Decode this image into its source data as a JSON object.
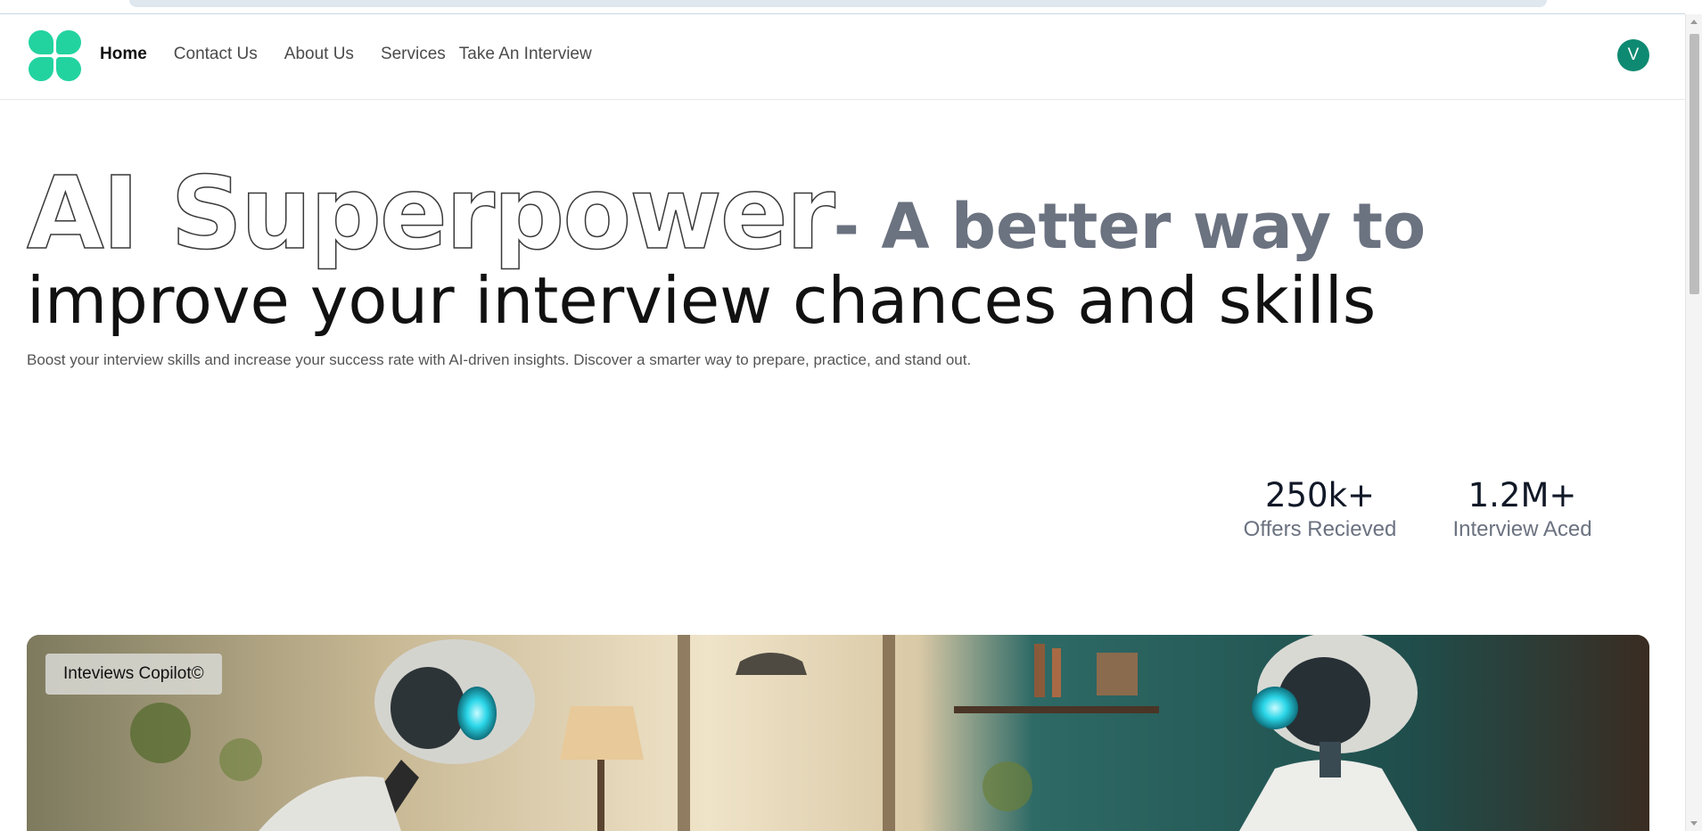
{
  "nav": {
    "home": "Home",
    "contact": "Contact Us",
    "about": "About Us",
    "services": "Services",
    "interview": "Take An Interview"
  },
  "user": {
    "avatar_initial": "V"
  },
  "hero": {
    "title_outline": "AI Superpower",
    "title_bold": "- A better way to",
    "title_line2": "improve your interview chances and skills",
    "subtitle": "Boost your interview skills and increase your success rate with AI-driven insights. Discover a smarter way to prepare, practice, and stand out."
  },
  "stats": [
    {
      "value": "250k+",
      "label": "Offers Recieved"
    },
    {
      "value": "1.2M+",
      "label": "Interview Aced"
    }
  ],
  "banner": {
    "badge": "Inteviews Copilot©"
  },
  "colors": {
    "brand": "#22d3a0",
    "avatar": "#0f8a72",
    "title_gray": "#6b7280"
  }
}
